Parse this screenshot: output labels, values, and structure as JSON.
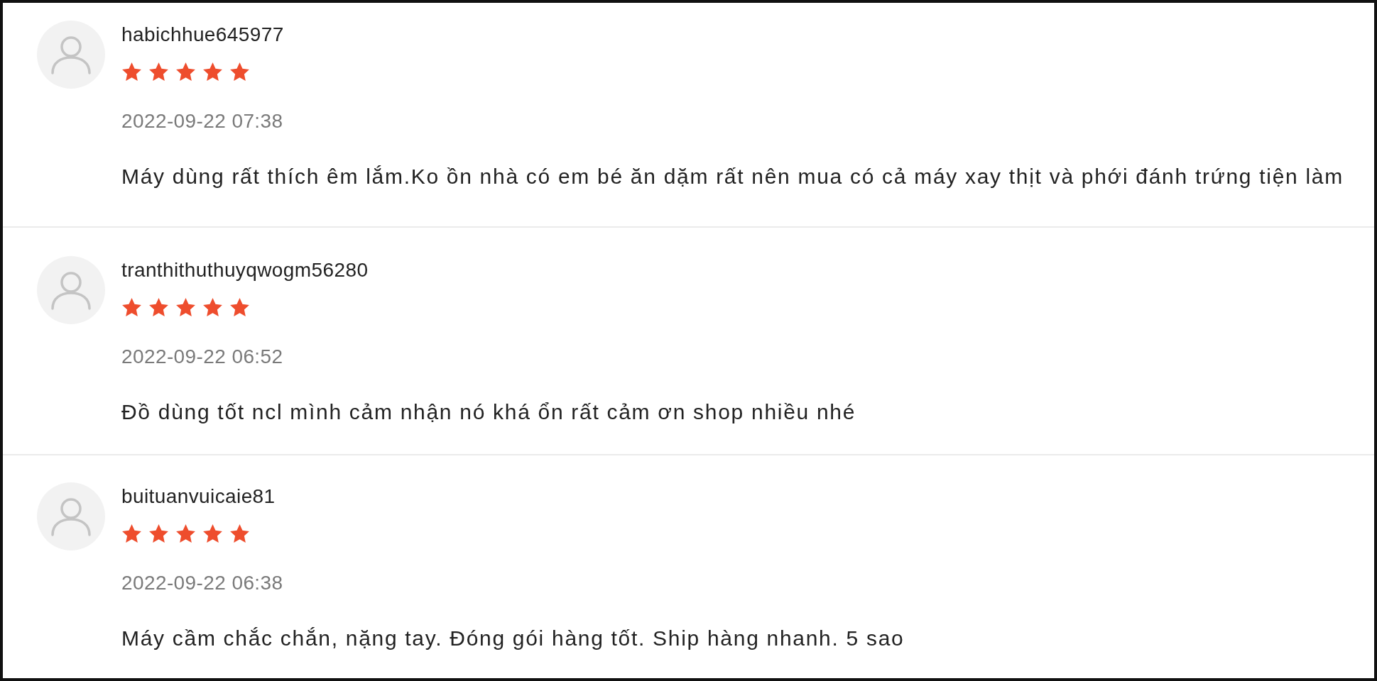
{
  "reviews": [
    {
      "username": "habichhue645977",
      "stars": 5,
      "date": "2022-09-22 07:38",
      "text": "Máy dùng rất thích êm lắm.Ko ồn nhà có em bé ăn dặm rất nên mua có cả máy xay thịt và phới đánh trứng tiện làm"
    },
    {
      "username": "tranthithuthuyqwogm56280",
      "stars": 5,
      "date": "2022-09-22 06:52",
      "text": "Đồ dùng tốt ncl mình cảm nhận nó khá ổn rất cảm ơn shop nhiều nhé"
    },
    {
      "username": "buituanvuicaie81",
      "stars": 5,
      "date": "2022-09-22 06:38",
      "text": "Máy cầm chắc chắn, nặng tay. Đóng gói hàng tốt. Ship hàng nhanh. 5 sao"
    }
  ]
}
